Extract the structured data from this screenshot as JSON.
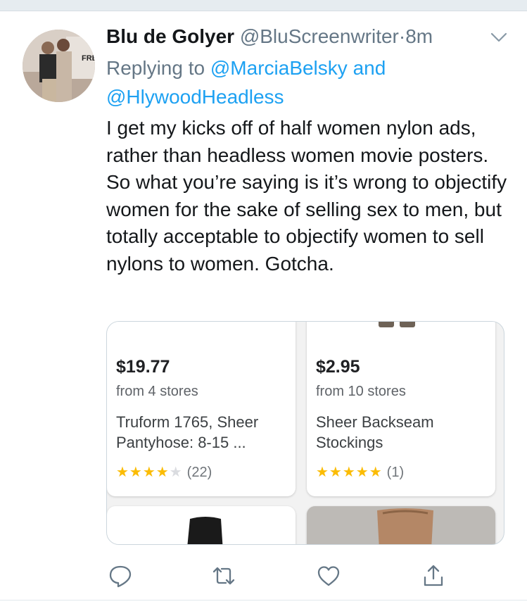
{
  "tweet": {
    "author_name": "Blu de Golyer",
    "author_handle": "@BluScreenwriter",
    "separator": "·",
    "time": "8m",
    "reply_prefix": "Replying to",
    "reply_to_1": "@MarciaBelsky",
    "reply_and": "and",
    "reply_to_2": "@HlywoodHeadless",
    "text": "I get my kicks off of half women nylon ads, rather than headless women movie posters. So what you’re saying is it’s wrong to objectify women for the sake of selling sex to men, but totally acceptable to objectify women to sell nylons to women. Gotcha."
  },
  "products": [
    {
      "price": "$19.77",
      "stores": "from 4 stores",
      "title": "Truform 1765, Sheer Pantyhose: 8-15 ...",
      "rating": 4,
      "stars_on": "★★★★",
      "stars_off": "★",
      "count": "(22)"
    },
    {
      "price": "$2.95",
      "stores": "from 10 stores",
      "title": "Sheer Backseam Stockings",
      "rating": 5,
      "stars_on": "★★★★★",
      "stars_off": "",
      "count": "(1)"
    }
  ],
  "icons": {
    "reply": "reply-icon",
    "retweet": "retweet-icon",
    "like": "heart-icon",
    "share": "share-icon",
    "more": "chevron-down-icon"
  },
  "colors": {
    "link": "#1da1f2",
    "muted": "#657786",
    "star": "#fbbc04"
  }
}
